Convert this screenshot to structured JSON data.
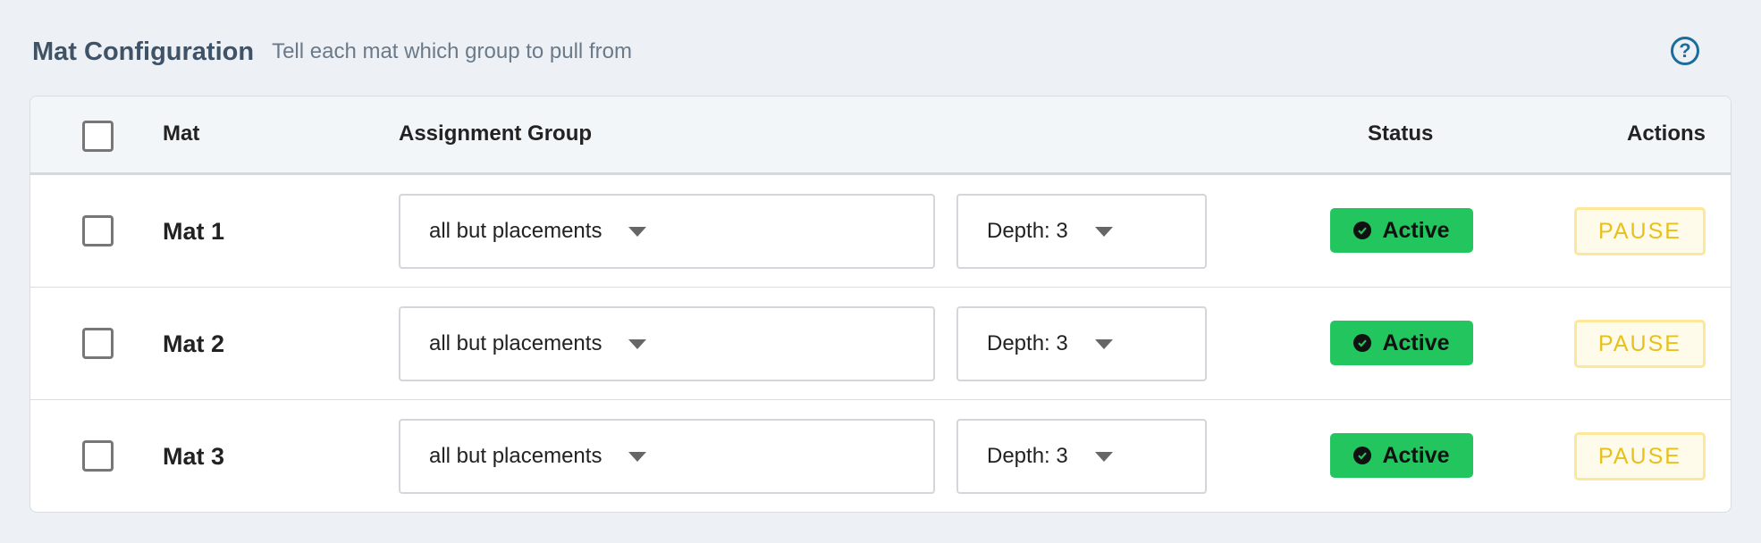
{
  "header": {
    "title": "Mat Configuration",
    "subtitle": "Tell each mat which group to pull from",
    "help_icon": "?"
  },
  "table": {
    "columns": {
      "mat": "Mat",
      "assignment_group": "Assignment Group",
      "status": "Status",
      "actions": "Actions"
    },
    "rows": [
      {
        "mat": "Mat 1",
        "group": "all but placements",
        "depth": "Depth: 3",
        "status": "Active",
        "action": "PAUSE"
      },
      {
        "mat": "Mat 2",
        "group": "all but placements",
        "depth": "Depth: 3",
        "status": "Active",
        "action": "PAUSE"
      },
      {
        "mat": "Mat 3",
        "group": "all but placements",
        "depth": "Depth: 3",
        "status": "Active",
        "action": "PAUSE"
      }
    ]
  },
  "colors": {
    "status_active": "#22c55e",
    "pause_text": "#e8c01b",
    "help": "#1a6d9c"
  }
}
